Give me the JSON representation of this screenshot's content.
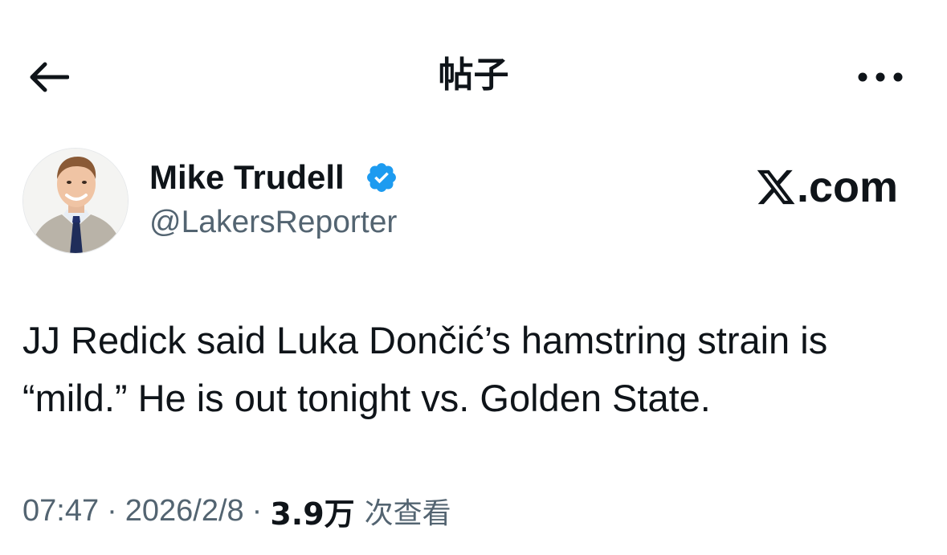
{
  "header": {
    "title": "帖子",
    "back_icon": "arrow-left-icon",
    "more_icon": "more-horizontal-icon"
  },
  "author": {
    "name": "Mike Trudell",
    "handle": "@LakersReporter",
    "verified": true,
    "verified_color": "#1d9bf0",
    "avatar": "avatar-photo"
  },
  "source": {
    "x_logo": "x-logo-icon",
    "domain": ".com"
  },
  "tweet": {
    "text": "JJ Redick said Luka Dončić’s hamstring strain is “mild.” He is out tonight vs. Golden State."
  },
  "meta": {
    "time": "07:47",
    "separator": "·",
    "date": "2026/2/8",
    "views_count": "3.9万",
    "views_label": "次查看"
  },
  "colors": {
    "text_primary": "#0f1419",
    "text_secondary": "#536471",
    "accent": "#1d9bf0"
  }
}
